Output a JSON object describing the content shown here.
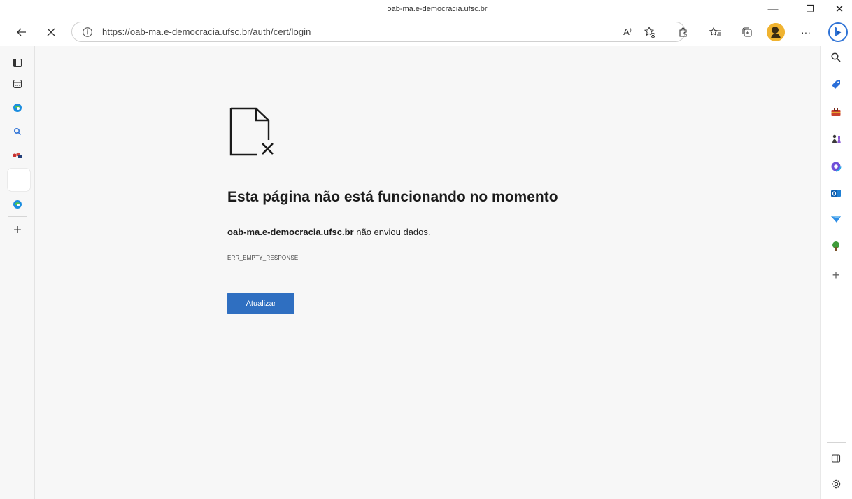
{
  "window": {
    "title": "oab-ma.e-democracia.ufsc.br",
    "minimize_glyph": "—",
    "restore_glyph": "❐",
    "close_glyph": "✕"
  },
  "toolbar": {
    "url": "https://oab-ma.e-democracia.ufsc.br/auth/cert/login",
    "read_aloud_glyph": "A⁾",
    "more_glyph": "···",
    "icons": [
      "back-icon",
      "stop-icon",
      "info-icon",
      "read-aloud-icon",
      "add-favorite-icon",
      "extensions-icon",
      "favorites-icon",
      "collections-icon",
      "profile-icon",
      "more-icon",
      "bing-icon"
    ]
  },
  "vertical_tabs": {
    "items": [
      "tab-actions-icon",
      "workspaces-icon",
      "edge-icon",
      "search-icon",
      "app-icon",
      "blank-tab",
      "edge-icon",
      "new-tab-icon"
    ],
    "add_glyph": "+"
  },
  "sidebar": {
    "items": [
      "search-icon",
      "shopping-icon",
      "tools-icon",
      "games-icon",
      "office-icon",
      "outlook-icon",
      "drop-icon",
      "tree-icon",
      "add-icon",
      "sidebar-toggle-icon",
      "settings-icon"
    ],
    "add_glyph": "+"
  },
  "error_page": {
    "title": "Esta página não está funcionando no momento",
    "host": "oab-ma.e-democracia.ufsc.br",
    "message": " não enviou dados.",
    "error_code": "ERR_EMPTY_RESPONSE",
    "reload_label": "Atualizar"
  },
  "colors": {
    "accent": "#2f6fc1",
    "content_background": "#f7f7f7",
    "text": "#1b1b1b"
  }
}
